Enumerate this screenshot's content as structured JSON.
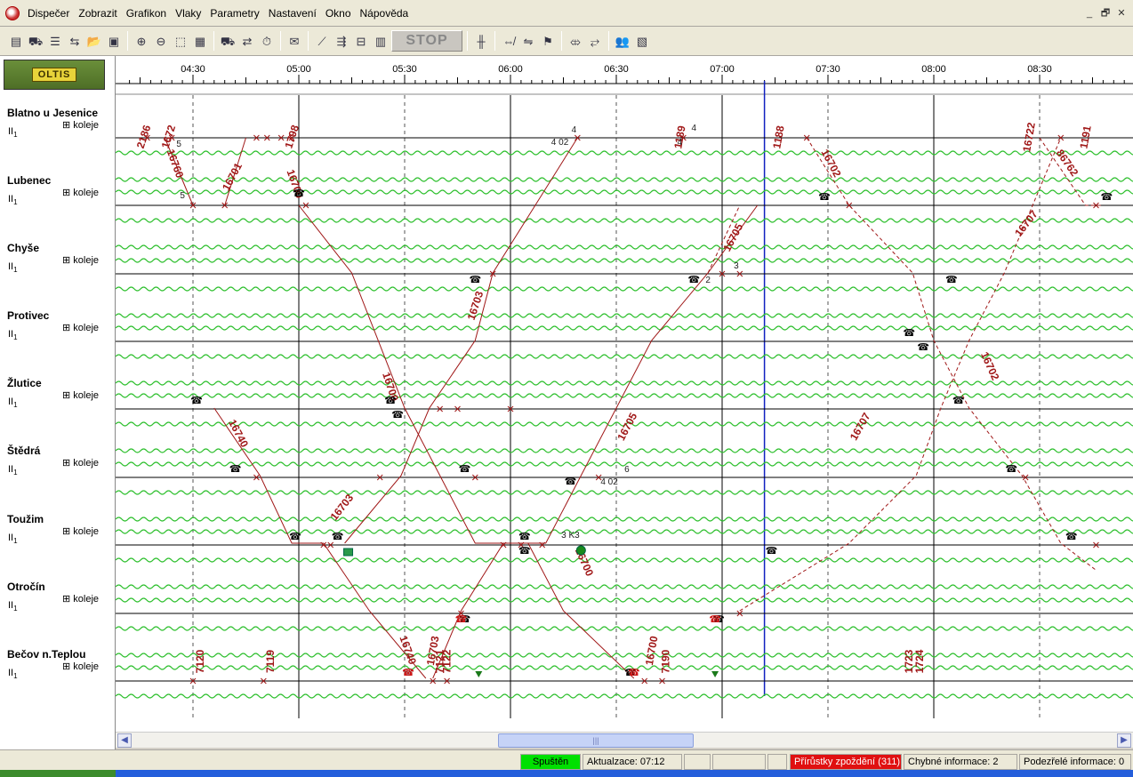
{
  "menu": [
    "Dispečer",
    "Zobrazit",
    "Grafikon",
    "Vlaky",
    "Parametry",
    "Nastavení",
    "Okno",
    "Nápověda"
  ],
  "window_controls": [
    "_",
    "🗗",
    "✕"
  ],
  "toolbar": {
    "icons_group1": [
      "dispatcher-icon",
      "train-icon",
      "train-list-icon",
      "locomotive-icon",
      "open-icon",
      "save-icon"
    ],
    "icons_group2": [
      "zoom-in-icon",
      "zoom-out-icon",
      "select-area-icon",
      "grid-icon"
    ],
    "icons_group3": [
      "add-train-icon",
      "train-route-icon",
      "timer-icon"
    ],
    "stop_label": "STOP"
  },
  "logo_text": "OLTIS",
  "time_axis": [
    "04:30",
    "05:00",
    "05:30",
    "06:00",
    "06:30",
    "07:00",
    "07:30",
    "08:00",
    "08:30"
  ],
  "stations": [
    {
      "name": "Blatno u Jesenice",
      "track": "II",
      "koleje": "koleje"
    },
    {
      "name": "Lubenec",
      "track": "II",
      "koleje": "koleje"
    },
    {
      "name": "Chyše",
      "track": "II",
      "koleje": "koleje"
    },
    {
      "name": "Protivec",
      "track": "II",
      "koleje": "koleje"
    },
    {
      "name": "Žlutice",
      "track": "II",
      "koleje": "koleje"
    },
    {
      "name": "Štědrá",
      "track": "II",
      "koleje": "koleje"
    },
    {
      "name": "Toužim",
      "track": "II",
      "koleje": "koleje"
    },
    {
      "name": "Otročín",
      "track": "II",
      "koleje": "koleje"
    },
    {
      "name": "Bečov n.Teplou",
      "track": "II",
      "koleje": "koleje"
    }
  ],
  "track_subscript": "1",
  "koleje_prefix": "⊞",
  "train_labels": [
    "2186",
    "1672",
    "1798",
    "16701",
    "16700",
    "16760",
    "16703",
    "16740",
    "16705",
    "16702",
    "16707",
    "1189",
    "1188",
    "16722",
    "1191",
    "86762",
    "7120",
    "7119",
    "7121",
    "7122",
    "7190",
    "1723",
    "1724"
  ],
  "statusbar": {
    "state": "Spuštěn",
    "update": "Aktualzace: 07:12",
    "delays": "Přírůstky zpoždění (311)",
    "errors": "Chybné informace: 2",
    "suspicious": "Podezřelé informace: 0"
  },
  "colors": {
    "train_line": "#a01818",
    "wave": "#2fc02f",
    "status_green": "#00e000",
    "status_red": "#e01010",
    "current_time": "#1020c0"
  }
}
